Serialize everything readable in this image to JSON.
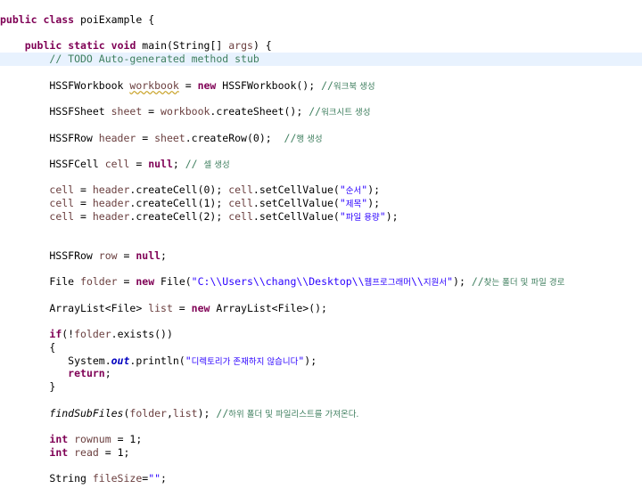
{
  "editor": {
    "lines": [
      {
        "tokens": [
          {
            "t": "public",
            "c": "kw"
          },
          {
            "t": " "
          },
          {
            "t": "class",
            "c": "kw"
          },
          {
            "t": " poiExample {"
          }
        ]
      },
      {
        "tokens": []
      },
      {
        "tokens": [
          {
            "t": "    "
          },
          {
            "t": "public",
            "c": "kw"
          },
          {
            "t": " "
          },
          {
            "t": "static",
            "c": "kw"
          },
          {
            "t": " "
          },
          {
            "t": "void",
            "c": "kw"
          },
          {
            "t": " main(String[] "
          },
          {
            "t": "args",
            "c": "lv"
          },
          {
            "t": ") {"
          }
        ]
      },
      {
        "current": true,
        "tokens": [
          {
            "t": "        "
          },
          {
            "t": "// TODO Auto-generated method stub",
            "c": "cm"
          }
        ]
      },
      {
        "tokens": []
      },
      {
        "tokens": [
          {
            "t": "        HSSFWorkbook "
          },
          {
            "t": "workbook",
            "c": "lv warn"
          },
          {
            "t": " = "
          },
          {
            "t": "new",
            "c": "kw"
          },
          {
            "t": " HSSFWorkbook(); "
          },
          {
            "t": "//",
            "c": "cm"
          },
          {
            "t": "워크북 생성",
            "c": "cm ko"
          }
        ]
      },
      {
        "tokens": []
      },
      {
        "tokens": [
          {
            "t": "        HSSFSheet "
          },
          {
            "t": "sheet",
            "c": "lv"
          },
          {
            "t": " = "
          },
          {
            "t": "workbook",
            "c": "lv"
          },
          {
            "t": ".createSheet(); "
          },
          {
            "t": "//",
            "c": "cm"
          },
          {
            "t": "워크시트 생성",
            "c": "cm ko"
          }
        ]
      },
      {
        "tokens": []
      },
      {
        "tokens": [
          {
            "t": "        HSSFRow "
          },
          {
            "t": "header",
            "c": "lv"
          },
          {
            "t": " = "
          },
          {
            "t": "sheet",
            "c": "lv"
          },
          {
            "t": ".createRow(0);  "
          },
          {
            "t": "//",
            "c": "cm"
          },
          {
            "t": "행 생성",
            "c": "cm ko"
          }
        ]
      },
      {
        "tokens": []
      },
      {
        "tokens": [
          {
            "t": "        HSSFCell "
          },
          {
            "t": "cell",
            "c": "lv"
          },
          {
            "t": " = "
          },
          {
            "t": "null",
            "c": "kw"
          },
          {
            "t": "; "
          },
          {
            "t": "// ",
            "c": "cm"
          },
          {
            "t": "셀 생성",
            "c": "cm ko"
          }
        ]
      },
      {
        "tokens": []
      },
      {
        "tokens": [
          {
            "t": "        "
          },
          {
            "t": "cell",
            "c": "lv"
          },
          {
            "t": " = "
          },
          {
            "t": "header",
            "c": "lv"
          },
          {
            "t": ".createCell(0); "
          },
          {
            "t": "cell",
            "c": "lv"
          },
          {
            "t": ".setCellValue("
          },
          {
            "t": "\"",
            "c": "st"
          },
          {
            "t": "순서",
            "c": "st ko"
          },
          {
            "t": "\"",
            "c": "st"
          },
          {
            "t": ");"
          }
        ]
      },
      {
        "tokens": [
          {
            "t": "        "
          },
          {
            "t": "cell",
            "c": "lv"
          },
          {
            "t": " = "
          },
          {
            "t": "header",
            "c": "lv"
          },
          {
            "t": ".createCell(1); "
          },
          {
            "t": "cell",
            "c": "lv"
          },
          {
            "t": ".setCellValue("
          },
          {
            "t": "\"",
            "c": "st"
          },
          {
            "t": "제목",
            "c": "st ko"
          },
          {
            "t": "\"",
            "c": "st"
          },
          {
            "t": ");"
          }
        ]
      },
      {
        "tokens": [
          {
            "t": "        "
          },
          {
            "t": "cell",
            "c": "lv"
          },
          {
            "t": " = "
          },
          {
            "t": "header",
            "c": "lv"
          },
          {
            "t": ".createCell(2); "
          },
          {
            "t": "cell",
            "c": "lv"
          },
          {
            "t": ".setCellValue("
          },
          {
            "t": "\"",
            "c": "st"
          },
          {
            "t": "파일 용량",
            "c": "st ko"
          },
          {
            "t": "\"",
            "c": "st"
          },
          {
            "t": ");"
          }
        ]
      },
      {
        "tokens": []
      },
      {
        "tokens": []
      },
      {
        "tokens": [
          {
            "t": "        HSSFRow "
          },
          {
            "t": "row",
            "c": "lv"
          },
          {
            "t": " = "
          },
          {
            "t": "null",
            "c": "kw"
          },
          {
            "t": ";"
          }
        ]
      },
      {
        "tokens": []
      },
      {
        "tokens": [
          {
            "t": "        File "
          },
          {
            "t": "folder",
            "c": "lv"
          },
          {
            "t": " = "
          },
          {
            "t": "new",
            "c": "kw"
          },
          {
            "t": " File("
          },
          {
            "t": "\"C:\\\\Users\\\\chang\\\\Desktop\\\\",
            "c": "st"
          },
          {
            "t": "웹프로그래머",
            "c": "st ko"
          },
          {
            "t": "\\\\",
            "c": "st"
          },
          {
            "t": "지원서",
            "c": "st ko"
          },
          {
            "t": "\"",
            "c": "st"
          },
          {
            "t": "); "
          },
          {
            "t": "//",
            "c": "cm"
          },
          {
            "t": "찾는 폴더 및 파일 경로",
            "c": "cm ko"
          }
        ]
      },
      {
        "tokens": []
      },
      {
        "tokens": [
          {
            "t": "        ArrayList<File> "
          },
          {
            "t": "list",
            "c": "lv"
          },
          {
            "t": " = "
          },
          {
            "t": "new",
            "c": "kw"
          },
          {
            "t": " ArrayList<File>();"
          }
        ]
      },
      {
        "tokens": []
      },
      {
        "tokens": [
          {
            "t": "        "
          },
          {
            "t": "if",
            "c": "kw"
          },
          {
            "t": "(!"
          },
          {
            "t": "folder",
            "c": "lv"
          },
          {
            "t": ".exists())"
          }
        ]
      },
      {
        "tokens": [
          {
            "t": "        {"
          }
        ]
      },
      {
        "tokens": [
          {
            "t": "           System."
          },
          {
            "t": "out",
            "c": "fd"
          },
          {
            "t": ".println("
          },
          {
            "t": "\"",
            "c": "st"
          },
          {
            "t": "디렉토리가 존재하지 않습니다",
            "c": "st ko"
          },
          {
            "t": "\"",
            "c": "st"
          },
          {
            "t": ");"
          }
        ]
      },
      {
        "tokens": [
          {
            "t": "           "
          },
          {
            "t": "return",
            "c": "kw"
          },
          {
            "t": ";"
          }
        ]
      },
      {
        "tokens": [
          {
            "t": "        }"
          }
        ]
      },
      {
        "tokens": []
      },
      {
        "tokens": [
          {
            "t": "        "
          },
          {
            "t": "findSubFiles",
            "c": "mi"
          },
          {
            "t": "("
          },
          {
            "t": "folder",
            "c": "lv"
          },
          {
            "t": ","
          },
          {
            "t": "list",
            "c": "lv"
          },
          {
            "t": "); "
          },
          {
            "t": "//",
            "c": "cm"
          },
          {
            "t": "하위 폴더 및 파일리스트를 가져온다.",
            "c": "cm ko"
          }
        ]
      },
      {
        "tokens": []
      },
      {
        "tokens": [
          {
            "t": "        "
          },
          {
            "t": "int",
            "c": "kw"
          },
          {
            "t": " "
          },
          {
            "t": "rownum",
            "c": "lv"
          },
          {
            "t": " = 1;"
          }
        ]
      },
      {
        "tokens": [
          {
            "t": "        "
          },
          {
            "t": "int",
            "c": "kw"
          },
          {
            "t": " "
          },
          {
            "t": "read",
            "c": "lv"
          },
          {
            "t": " = 1;"
          }
        ]
      },
      {
        "tokens": []
      },
      {
        "tokens": [
          {
            "t": "        String "
          },
          {
            "t": "fileSize",
            "c": "lv"
          },
          {
            "t": "="
          },
          {
            "t": "\"\"",
            "c": "st"
          },
          {
            "t": ";"
          }
        ]
      }
    ]
  }
}
